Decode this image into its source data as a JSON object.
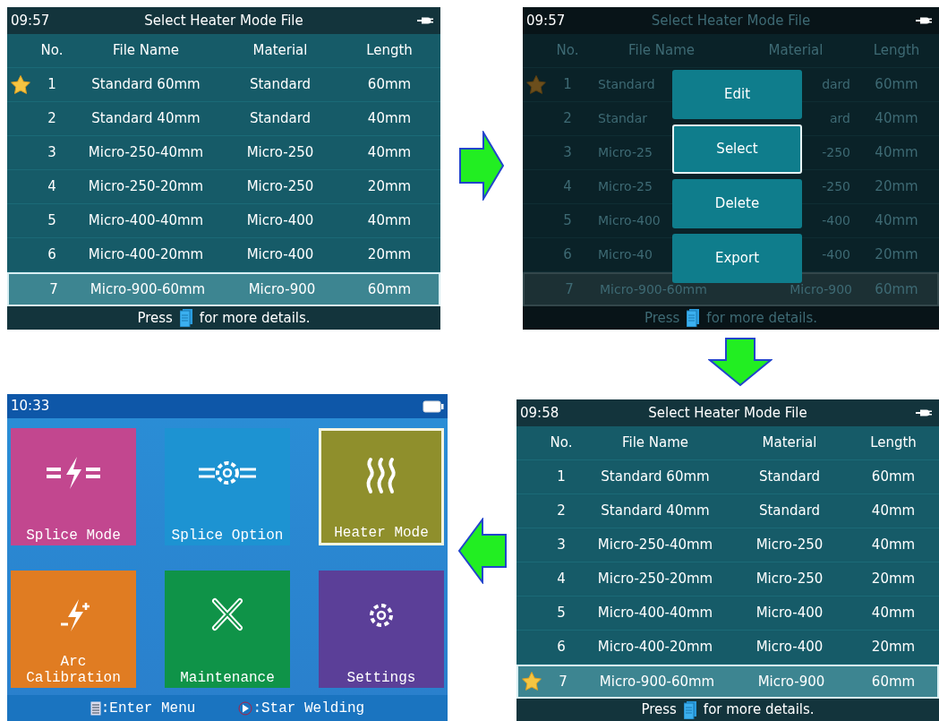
{
  "screens": [
    {
      "kind": "list",
      "time": "09:57",
      "title": "Select Heater Mode File",
      "dimmed": false,
      "columns": [
        "No.",
        "File Name",
        "Material",
        "Length"
      ],
      "rows": [
        {
          "no": "1",
          "file_name": "Standard 60mm",
          "material": "Standard",
          "length": "60mm",
          "starred": true,
          "selected": false
        },
        {
          "no": "2",
          "file_name": "Standard 40mm",
          "material": "Standard",
          "length": "40mm",
          "starred": false,
          "selected": false
        },
        {
          "no": "3",
          "file_name": "Micro-250-40mm",
          "material": "Micro-250",
          "length": "40mm",
          "starred": false,
          "selected": false
        },
        {
          "no": "4",
          "file_name": "Micro-250-20mm",
          "material": "Micro-250",
          "length": "20mm",
          "starred": false,
          "selected": false
        },
        {
          "no": "5",
          "file_name": "Micro-400-40mm",
          "material": "Micro-400",
          "length": "40mm",
          "starred": false,
          "selected": false
        },
        {
          "no": "6",
          "file_name": "Micro-400-20mm",
          "material": "Micro-400",
          "length": "20mm",
          "starred": false,
          "selected": false
        },
        {
          "no": "7",
          "file_name": "Micro-900-60mm",
          "material": "Micro-900",
          "length": "60mm",
          "starred": false,
          "selected": true
        }
      ],
      "footer": {
        "before": "Press",
        "after": "for more details."
      }
    },
    {
      "kind": "list",
      "time": "09:57",
      "title": "Select Heater Mode File",
      "dimmed": true,
      "columns": [
        "No.",
        "File Name",
        "Material",
        "Length"
      ],
      "rows": [
        {
          "no": "1",
          "file_name": "Standard",
          "material": "dard",
          "length": "60mm",
          "starred": true,
          "selected": false
        },
        {
          "no": "2",
          "file_name": "Standar",
          "material": "ard",
          "length": "40mm",
          "starred": false,
          "selected": false
        },
        {
          "no": "3",
          "file_name": "Micro-25",
          "material": "-250",
          "length": "40mm",
          "starred": false,
          "selected": false
        },
        {
          "no": "4",
          "file_name": "Micro-25",
          "material": "-250",
          "length": "20mm",
          "starred": false,
          "selected": false
        },
        {
          "no": "5",
          "file_name": "Micro-400",
          "material": "-400",
          "length": "40mm",
          "starred": false,
          "selected": false
        },
        {
          "no": "6",
          "file_name": "Micro-40",
          "material": "-400",
          "length": "20mm",
          "starred": false,
          "selected": false
        },
        {
          "no": "7",
          "file_name": "Micro-900-60mm",
          "material": "Micro-900",
          "length": "60mm",
          "starred": false,
          "selected": true
        }
      ],
      "menu": [
        {
          "label": "Edit",
          "selected": false
        },
        {
          "label": "Select",
          "selected": true
        },
        {
          "label": "Delete",
          "selected": false
        },
        {
          "label": "Export",
          "selected": false
        }
      ],
      "footer": {
        "before": "Press",
        "after": "for more details."
      }
    },
    {
      "kind": "home",
      "time": "10:33",
      "tiles": [
        {
          "label": "Splice Mode",
          "kind": "splice",
          "color": "#c2478f",
          "selected": false
        },
        {
          "label": "Splice Option",
          "kind": "option",
          "color": "#1d93d2",
          "selected": false
        },
        {
          "label": "Heater Mode",
          "kind": "heater",
          "color": "#8f8f2c",
          "selected": true
        },
        {
          "label": "Arc Calibration",
          "kind": "arc",
          "color": "#e07c22",
          "selected": false
        },
        {
          "label": "Maintenance",
          "kind": "tools",
          "color": "#0f9348",
          "selected": false
        },
        {
          "label": "Settings",
          "kind": "gear",
          "color": "#5b3f98",
          "selected": false
        }
      ],
      "hints": [
        {
          "kind": "menu",
          "text": ":Enter Menu"
        },
        {
          "kind": "play",
          "text": ":Star Welding"
        }
      ]
    },
    {
      "kind": "list",
      "time": "09:58",
      "title": "Select Heater Mode File",
      "dimmed": false,
      "columns": [
        "No.",
        "File Name",
        "Material",
        "Length"
      ],
      "rows": [
        {
          "no": "1",
          "file_name": "Standard 60mm",
          "material": "Standard",
          "length": "60mm",
          "starred": false,
          "selected": false
        },
        {
          "no": "2",
          "file_name": "Standard 40mm",
          "material": "Standard",
          "length": "40mm",
          "starred": false,
          "selected": false
        },
        {
          "no": "3",
          "file_name": "Micro-250-40mm",
          "material": "Micro-250",
          "length": "40mm",
          "starred": false,
          "selected": false
        },
        {
          "no": "4",
          "file_name": "Micro-250-20mm",
          "material": "Micro-250",
          "length": "20mm",
          "starred": false,
          "selected": false
        },
        {
          "no": "5",
          "file_name": "Micro-400-40mm",
          "material": "Micro-400",
          "length": "40mm",
          "starred": false,
          "selected": false
        },
        {
          "no": "6",
          "file_name": "Micro-400-20mm",
          "material": "Micro-400",
          "length": "20mm",
          "starred": false,
          "selected": false
        },
        {
          "no": "7",
          "file_name": "Micro-900-60mm",
          "material": "Micro-900",
          "length": "60mm",
          "starred": true,
          "selected": true
        }
      ],
      "footer": {
        "before": "Press",
        "after": "for more details."
      }
    }
  ]
}
